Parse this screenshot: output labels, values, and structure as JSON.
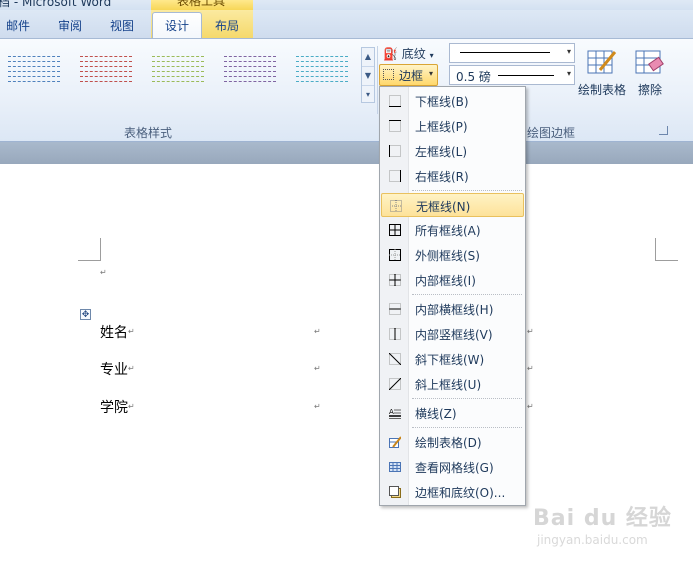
{
  "title": {
    "text": "档 - Microsoft Word",
    "context_group": "表格工具"
  },
  "tabs": [
    {
      "label": "邮件"
    },
    {
      "label": "审阅"
    },
    {
      "label": "视图"
    },
    {
      "label": "设计",
      "active": true
    },
    {
      "label": "布局"
    }
  ],
  "ribbon": {
    "table_styles_label": "表格样式",
    "draw_borders_label": "绘图边框",
    "shading_label": "底纹",
    "borders_label": "边框",
    "pen_weight": "0.5 磅",
    "draw_table_label": "绘制表格",
    "eraser_label": "擦除",
    "style_colors": [
      "#4f81bd",
      "#c0504d",
      "#9bbb59",
      "#8064a2",
      "#4bacc6"
    ]
  },
  "menu": {
    "items": [
      {
        "label": "下框线(B)",
        "icon": "bottom-border-icon"
      },
      {
        "label": "上框线(P)",
        "icon": "top-border-icon"
      },
      {
        "label": "左框线(L)",
        "icon": "left-border-icon"
      },
      {
        "label": "右框线(R)",
        "icon": "right-border-icon"
      },
      {
        "label": "无框线(N)",
        "icon": "no-border-icon",
        "highlighted": true
      },
      {
        "label": "所有框线(A)",
        "icon": "all-borders-icon"
      },
      {
        "label": "外侧框线(S)",
        "icon": "outside-borders-icon"
      },
      {
        "label": "内部框线(I)",
        "icon": "inside-borders-icon"
      },
      {
        "label": "内部横框线(H)",
        "icon": "inside-horizontal-border-icon"
      },
      {
        "label": "内部竖框线(V)",
        "icon": "inside-vertical-border-icon"
      },
      {
        "label": "斜下框线(W)",
        "icon": "diagonal-down-border-icon"
      },
      {
        "label": "斜上框线(U)",
        "icon": "diagonal-up-border-icon"
      },
      {
        "label": "横线(Z)",
        "icon": "horizontal-line-icon"
      },
      {
        "label": "绘制表格(D)",
        "icon": "draw-table-icon"
      },
      {
        "label": "查看网格线(G)",
        "icon": "view-gridlines-icon"
      },
      {
        "label": "边框和底纹(O)...",
        "icon": "borders-shading-icon"
      }
    ]
  },
  "document": {
    "paragraph_mark": "↵",
    "rows": [
      {
        "label": "姓名"
      },
      {
        "label": "专业"
      },
      {
        "label": "学院"
      }
    ]
  },
  "watermark": {
    "brand": "Bai du 经验",
    "url": "jingyan.baidu.com"
  }
}
